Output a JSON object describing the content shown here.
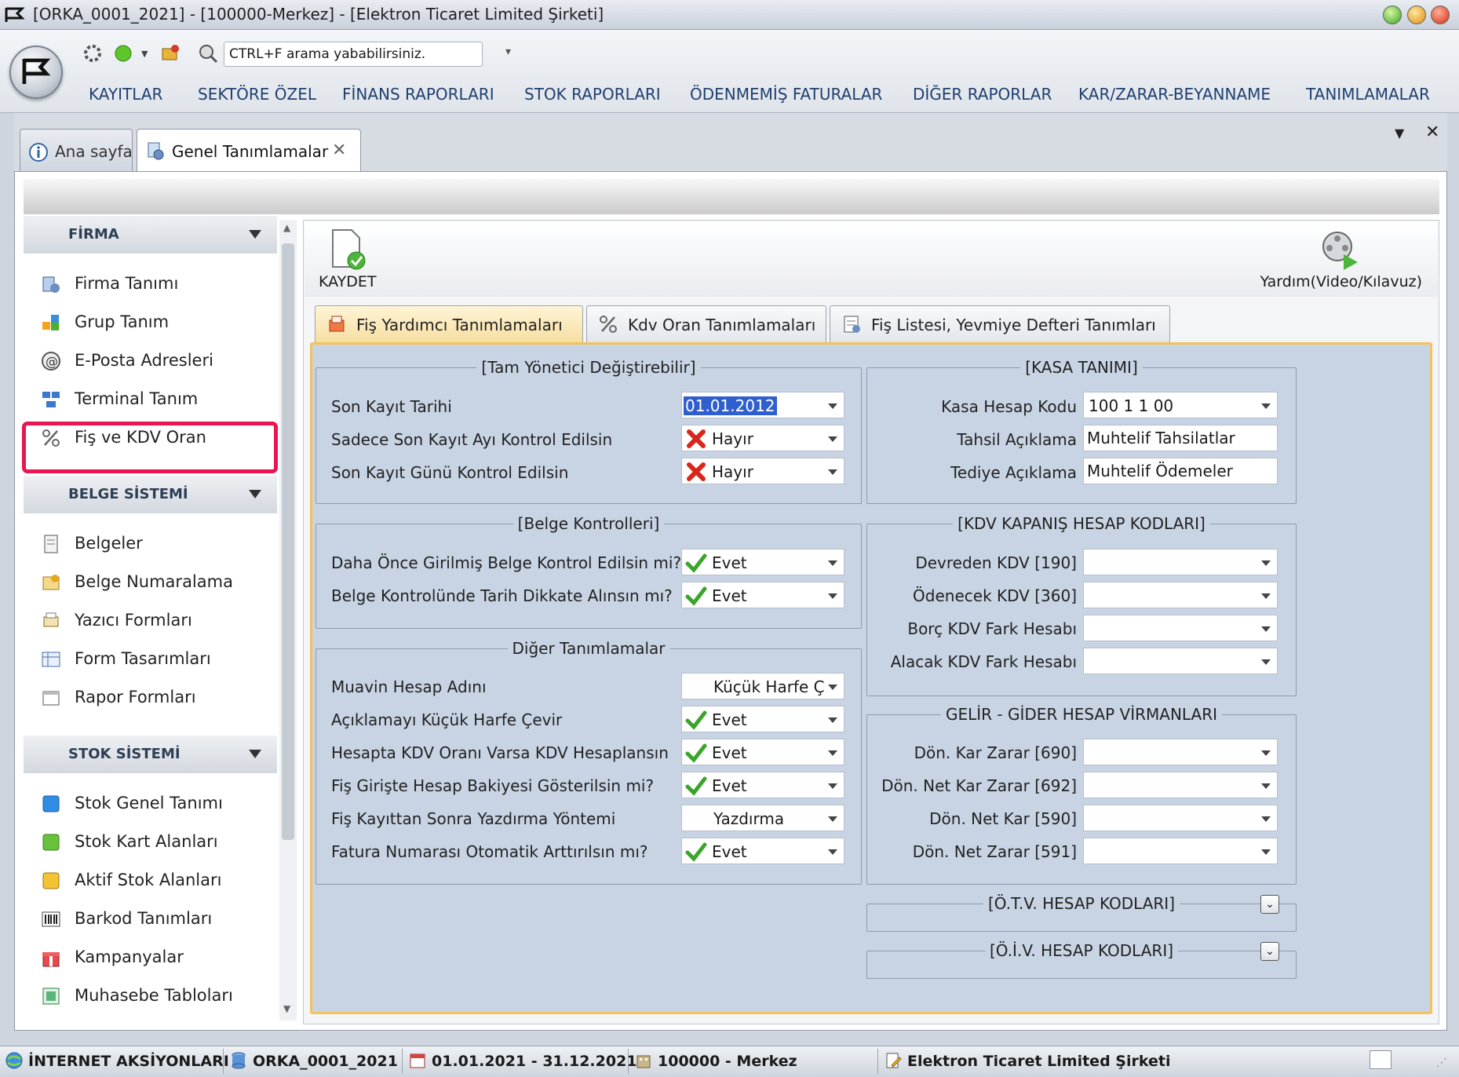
{
  "window": {
    "title": "[ORKA_0001_2021]   -   [100000-Merkez]   -   [Elektron Ticaret Limited Şirketi]"
  },
  "quick_access": {
    "search_placeholder": "CTRL+F arama yababilirsiniz."
  },
  "menu": [
    "KAYITLAR",
    "SEKTÖRE ÖZEL",
    "FİNANS RAPORLARI",
    "STOK RAPORLARI",
    "ÖDENMEMİŞ FATURALAR",
    "DİĞER RAPORLAR",
    "KAR/ZARAR-BEYANNAME",
    "TANIMLAMALAR"
  ],
  "doc_tabs": {
    "home": "Ana sayfa",
    "current": "Genel Tanımlamalar"
  },
  "sidebar": {
    "sections": [
      {
        "title": "FİRMA",
        "items": [
          "Firma Tanımı",
          "Grup Tanım",
          "E-Posta Adresleri",
          "Terminal Tanım",
          "Fiş ve KDV Oran"
        ]
      },
      {
        "title": "BELGE SİSTEMİ",
        "items": [
          "Belgeler",
          "Belge Numaralama",
          "Yazıcı Formları",
          "Form Tasarımları",
          "Rapor Formları"
        ]
      },
      {
        "title": "STOK SİSTEMİ",
        "items": [
          "Stok Genel Tanımı",
          "Stok Kart Alanları",
          "Aktif Stok Alanları",
          "Barkod Tanımları",
          "Kampanyalar",
          "Muhasebe Tabloları"
        ]
      }
    ],
    "highlighted_item": "Fiş ve KDV Oran",
    "highlight_color": "#e8174f"
  },
  "toolbar": {
    "save_label": "KAYDET",
    "help_label": "Yardım(Video/Kılavuz)"
  },
  "form_tabs": [
    "Fiş Yardımcı Tanımlamaları",
    "Kdv Oran Tanımlamaları",
    "Fiş Listesi, Yevmiye Defteri Tanımları"
  ],
  "groups": {
    "tam_yonetici": {
      "title": "[Tam Yönetici Değiştirebilir]",
      "rows": [
        {
          "label": "Son Kayıt Tarihi",
          "value": "01.01.2012",
          "icon": "none"
        },
        {
          "label": "Sadece Son Kayıt Ayı Kontrol Edilsin",
          "value": "Hayır",
          "icon": "cross"
        },
        {
          "label": "Son Kayıt Günü Kontrol Edilsin",
          "value": "Hayır",
          "icon": "cross"
        }
      ]
    },
    "belge_kontrolleri": {
      "title": "[Belge Kontrolleri]",
      "rows": [
        {
          "label": "Daha Önce Girilmiş Belge Kontrol Edilsin mi?",
          "value": "Evet",
          "icon": "check"
        },
        {
          "label": "Belge Kontrolünde Tarih Dikkate Alınsın mı?",
          "value": "Evet",
          "icon": "check"
        }
      ]
    },
    "diger": {
      "title": "Diğer Tanımlamalar",
      "rows": [
        {
          "label": "Muavin Hesap Adını",
          "value": "Küçük Harfe Ç",
          "icon": "none"
        },
        {
          "label": "Açıklamayı Küçük Harfe Çevir",
          "value": "Evet",
          "icon": "check"
        },
        {
          "label": "Hesapta KDV Oranı Varsa KDV Hesaplansın",
          "value": "Evet",
          "icon": "check"
        },
        {
          "label": "Fiş Girişte Hesap Bakiyesi Gösterilsin mi?",
          "value": "Evet",
          "icon": "check"
        },
        {
          "label": "Fiş Kayıttan Sonra Yazdırma Yöntemi",
          "value": "Yazdırma",
          "icon": "none"
        },
        {
          "label": "Fatura Numarası Otomatik Arttırılsın mı?",
          "value": "Evet",
          "icon": "check"
        }
      ]
    },
    "kasa": {
      "title": "[KASA TANIMI]",
      "rows": [
        {
          "label": "Kasa Hesap Kodu",
          "value": "100 1 1 00",
          "type": "combo"
        },
        {
          "label": "Tahsil Açıklama",
          "value": "Muhtelif Tahsilatlar",
          "type": "text"
        },
        {
          "label": "Tediye Açıklama",
          "value": "Muhtelif Ödemeler",
          "type": "text"
        }
      ]
    },
    "kdv_kapanis": {
      "title": "[KDV KAPANIŞ HESAP KODLARI]",
      "rows": [
        {
          "label": "Devreden KDV [190]",
          "value": ""
        },
        {
          "label": "Ödenecek KDV [360]",
          "value": ""
        },
        {
          "label": "Borç KDV Fark Hesabı",
          "value": ""
        },
        {
          "label": "Alacak KDV Fark Hesabı",
          "value": ""
        }
      ]
    },
    "gelir_gider": {
      "title": "GELİR - GİDER HESAP VİRMANLARI",
      "rows": [
        {
          "label": "Dön. Kar Zarar [690]",
          "value": ""
        },
        {
          "label": "Dön. Net Kar Zarar [692]",
          "value": ""
        },
        {
          "label": "Dön. Net Kar [590]",
          "value": ""
        },
        {
          "label": "Dön. Net Zarar [591]",
          "value": ""
        }
      ]
    },
    "otv": {
      "title": "[Ö.T.V. HESAP KODLARI]"
    },
    "oiv": {
      "title": "[Ö.İ.V.  HESAP KODLARI]"
    }
  },
  "statusbar": {
    "internet": "İNTERNET AKSİYONLARI",
    "database": "ORKA_0001_2021",
    "period": "01.01.2021 - 31.12.2021",
    "branch": "100000 - Merkez",
    "company": "Elektron Ticaret Limited Şirketi"
  }
}
